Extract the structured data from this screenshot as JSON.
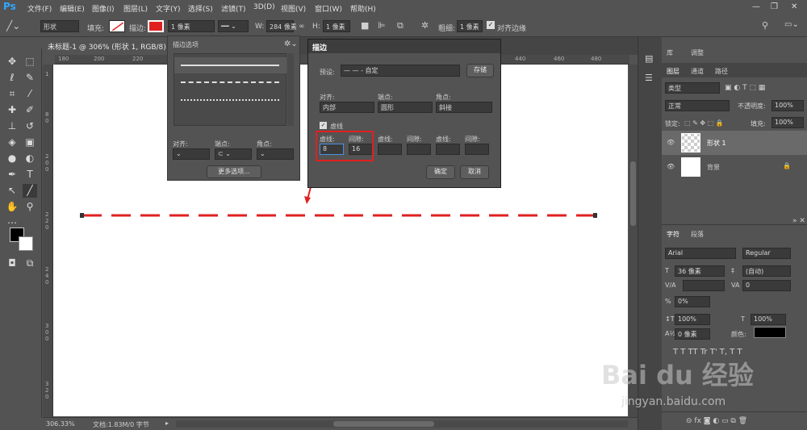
{
  "app": {
    "logo": "Ps"
  },
  "menu": [
    "文件(F)",
    "编辑(E)",
    "图像(I)",
    "图层(L)",
    "文字(Y)",
    "选择(S)",
    "滤镜(T)",
    "3D(D)",
    "视图(V)",
    "窗口(W)",
    "帮助(H)"
  ],
  "window_controls": {
    "minimize": "—",
    "restore": "❐",
    "close": "✕"
  },
  "options_bar": {
    "shape_mode": "形状",
    "fill_label": "填充:",
    "stroke_label": "描边:",
    "stroke_width": "1 像素",
    "w_label": "W:",
    "w_value": "284 像素",
    "h_label": "H:",
    "h_value": "1 像素",
    "weight_label": "粗细:",
    "weight_value": "1 像素",
    "align_edges_label": "对齐边缘",
    "colors": {
      "stroke": "#e02020"
    }
  },
  "document_tab": {
    "title": "未标题-1 @ 306% (形状 1, RGB/8) *"
  },
  "ruler_h_ticks": [
    "180",
    "200",
    "220",
    "440",
    "460",
    "480"
  ],
  "ruler_v_ticks": [
    "1",
    "8",
    "0",
    "2",
    "0",
    "0",
    "2",
    "2",
    "0",
    "2",
    "4",
    "0",
    "2",
    "6",
    "0",
    "2",
    "8",
    "0",
    "3",
    "0",
    "0",
    "3",
    "2",
    "0"
  ],
  "stroke_options_panel": {
    "title": "描边选项",
    "align_label": "对齐:",
    "caps_label": "端点:",
    "corners_label": "角点:",
    "more_button": "更多选项..."
  },
  "stroke_dialog": {
    "title": "描边",
    "preset_label": "预设:",
    "preset_value": "— — - 自定",
    "save_button": "存储",
    "align_label": "对齐:",
    "align_value": "内部",
    "caps_label": "端点:",
    "caps_value": "圆形",
    "corners_label": "角点:",
    "corners_value": "斜接",
    "dashed_label": "虚线",
    "dash_label": "虚线:",
    "gap_label": "间隙:",
    "dash1_value": "8",
    "gap1_value": "16",
    "ok_button": "确定",
    "cancel_button": "取消",
    "colors": {
      "highlight": "#e02020"
    }
  },
  "status_bar": {
    "zoom": "306.33%",
    "doc_info": "文档:1.83M/0 字节"
  },
  "panels": {
    "tabs_top": [
      "库",
      "调整"
    ],
    "layers_tabs": [
      "图层",
      "通道",
      "路径"
    ],
    "kind_label": "类型",
    "blend_mode": "正常",
    "opacity_label": "不透明度:",
    "opacity_value": "100%",
    "lock_label": "锁定:",
    "fill_label": "填充:",
    "fill_value": "100%",
    "layers": [
      {
        "name": "形状 1"
      },
      {
        "name": "背景"
      }
    ]
  },
  "char_panel": {
    "tabs": [
      "字符",
      "段落"
    ],
    "font_family": "Arial",
    "font_style": "Regular",
    "font_size": "36 像素",
    "leading": "(自动)",
    "kerning_label": "V/A",
    "tracking_value": "0",
    "scale_pct": "0%",
    "vscale": "100%",
    "hscale": "100%",
    "baseline": "0 像素",
    "color_label": "颜色:",
    "type_buttons": [
      "T",
      "T",
      "TT",
      "Tr",
      "T'",
      "T,",
      "T",
      "T"
    ]
  },
  "watermark": {
    "brand": "Bai du 经验",
    "url": "jingyan.baidu.com"
  }
}
